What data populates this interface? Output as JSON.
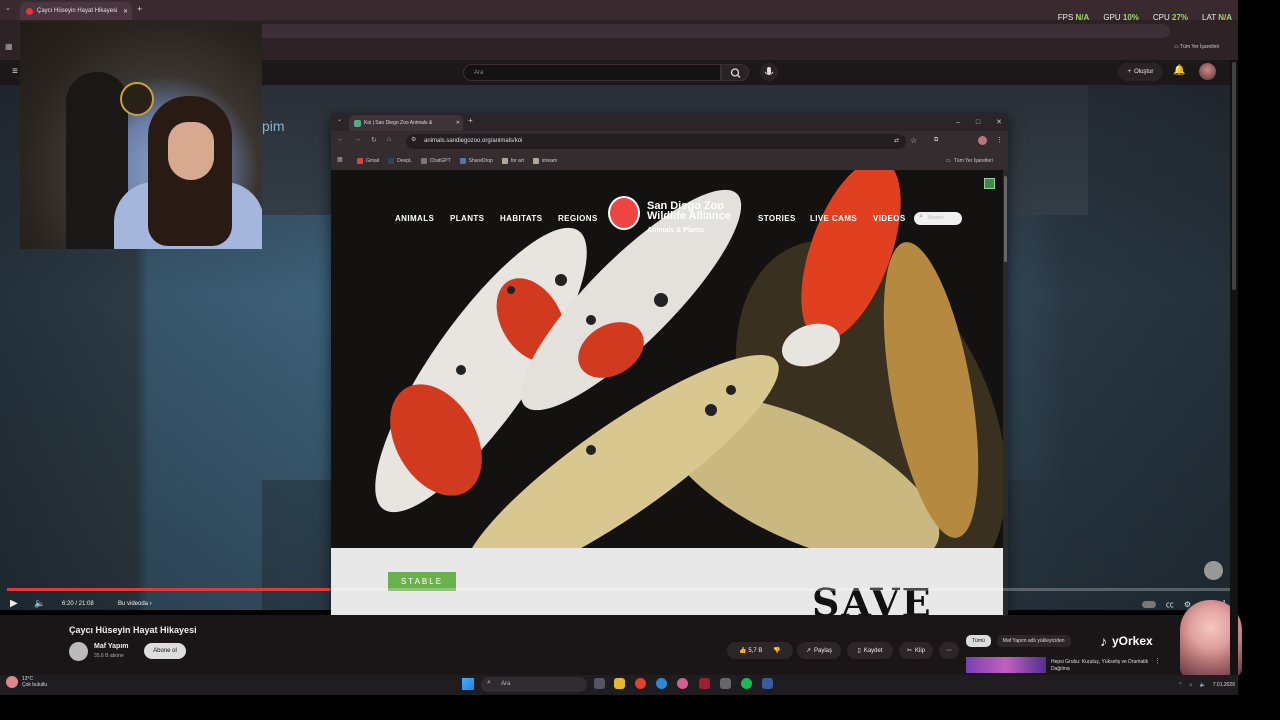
{
  "outer_browser": {
    "tab_title": "Çaycı Hüseyin Hayat Hikayesi",
    "all_bookmarks": "Tüm Yer İşaretleri"
  },
  "overlay": {
    "fps_label": "FPS",
    "fps_value": "N/A",
    "gpu_label": "GPU",
    "gpu_value": "10%",
    "cpu_label": "CPU",
    "cpu_value": "27%",
    "lat_label": "LAT",
    "lat_value": "N/A"
  },
  "youtube": {
    "search_placeholder": "Ara",
    "create_label": "Oluştur",
    "faded_overlay_text": "pim",
    "player": {
      "time": "6:20 / 21:08",
      "chapter": "Bu videoda",
      "progress_fraction": 0.263
    },
    "video_title": "Çaycı Hüseyin Hayat Hikayesi",
    "channel_name": "Maf Yapım",
    "channel_subs": "35,6 B abone",
    "subscribe_label": "Abone ol",
    "likes": "5,7 B",
    "share_label": "Paylaş",
    "save_label": "Kaydet",
    "clip_label": "Klip",
    "rec_tabs": [
      "Tümü",
      "Maf Yapım adlı yükleyiciden"
    ],
    "rec_title": "Hepsi Grubu: Kuruluş, Yükseliş ve Dramatik Dağılma",
    "tiktok_user": "yOrkex"
  },
  "popup": {
    "tab_title": "Koi | San Diego Zoo Animals &",
    "url": "animals.sandiegozoo.org/animals/koi",
    "bookmarks": [
      "Gmail",
      "DeepL",
      "ChatGPT",
      "ShareDrop",
      "for art",
      "stream"
    ],
    "all_bookmarks": "Tüm Yer İşaretleri"
  },
  "zoo": {
    "nav_left": [
      "ANIMALS",
      "PLANTS",
      "HABITATS",
      "REGIONS"
    ],
    "nav_right": [
      "STORIES",
      "LIVE CAMS",
      "VIDEOS"
    ],
    "logo_line1": "San Diego Zoo",
    "logo_line2": "Wildlife Alliance",
    "logo_sub": "Animals & Plants",
    "search_placeholder": "Search",
    "status_badge": "STABLE",
    "headline": "SAVE"
  },
  "taskbar": {
    "weather_temp": "13°C",
    "weather_desc": "Çok bulutlu",
    "search_placeholder": "Ara",
    "date": "7.01.2026"
  },
  "colors": {
    "accent_red": "#e33333",
    "stable_green": "#6ab04c",
    "overlay_green": "#9fd65f"
  }
}
